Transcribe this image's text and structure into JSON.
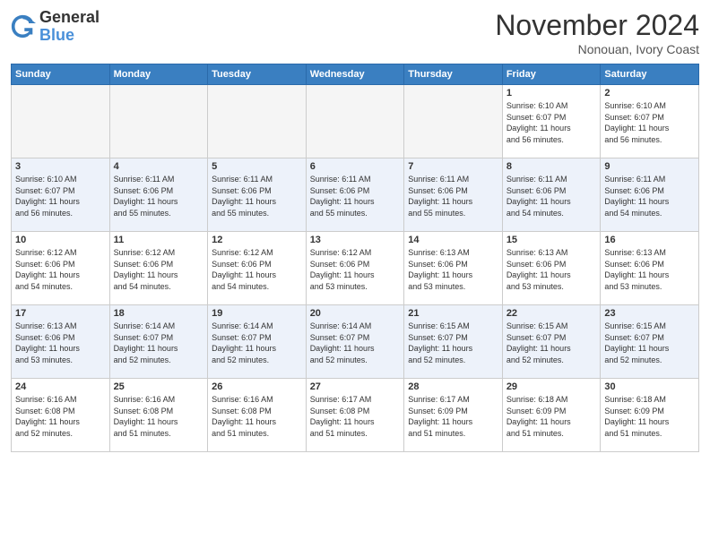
{
  "header": {
    "logo_line1": "General",
    "logo_line2": "Blue",
    "month": "November 2024",
    "location": "Nonouan, Ivory Coast"
  },
  "weekdays": [
    "Sunday",
    "Monday",
    "Tuesday",
    "Wednesday",
    "Thursday",
    "Friday",
    "Saturday"
  ],
  "weeks": [
    [
      {
        "day": "",
        "info": ""
      },
      {
        "day": "",
        "info": ""
      },
      {
        "day": "",
        "info": ""
      },
      {
        "day": "",
        "info": ""
      },
      {
        "day": "",
        "info": ""
      },
      {
        "day": "1",
        "info": "Sunrise: 6:10 AM\nSunset: 6:07 PM\nDaylight: 11 hours\nand 56 minutes."
      },
      {
        "day": "2",
        "info": "Sunrise: 6:10 AM\nSunset: 6:07 PM\nDaylight: 11 hours\nand 56 minutes."
      }
    ],
    [
      {
        "day": "3",
        "info": "Sunrise: 6:10 AM\nSunset: 6:07 PM\nDaylight: 11 hours\nand 56 minutes."
      },
      {
        "day": "4",
        "info": "Sunrise: 6:11 AM\nSunset: 6:06 PM\nDaylight: 11 hours\nand 55 minutes."
      },
      {
        "day": "5",
        "info": "Sunrise: 6:11 AM\nSunset: 6:06 PM\nDaylight: 11 hours\nand 55 minutes."
      },
      {
        "day": "6",
        "info": "Sunrise: 6:11 AM\nSunset: 6:06 PM\nDaylight: 11 hours\nand 55 minutes."
      },
      {
        "day": "7",
        "info": "Sunrise: 6:11 AM\nSunset: 6:06 PM\nDaylight: 11 hours\nand 55 minutes."
      },
      {
        "day": "8",
        "info": "Sunrise: 6:11 AM\nSunset: 6:06 PM\nDaylight: 11 hours\nand 54 minutes."
      },
      {
        "day": "9",
        "info": "Sunrise: 6:11 AM\nSunset: 6:06 PM\nDaylight: 11 hours\nand 54 minutes."
      }
    ],
    [
      {
        "day": "10",
        "info": "Sunrise: 6:12 AM\nSunset: 6:06 PM\nDaylight: 11 hours\nand 54 minutes."
      },
      {
        "day": "11",
        "info": "Sunrise: 6:12 AM\nSunset: 6:06 PM\nDaylight: 11 hours\nand 54 minutes."
      },
      {
        "day": "12",
        "info": "Sunrise: 6:12 AM\nSunset: 6:06 PM\nDaylight: 11 hours\nand 54 minutes."
      },
      {
        "day": "13",
        "info": "Sunrise: 6:12 AM\nSunset: 6:06 PM\nDaylight: 11 hours\nand 53 minutes."
      },
      {
        "day": "14",
        "info": "Sunrise: 6:13 AM\nSunset: 6:06 PM\nDaylight: 11 hours\nand 53 minutes."
      },
      {
        "day": "15",
        "info": "Sunrise: 6:13 AM\nSunset: 6:06 PM\nDaylight: 11 hours\nand 53 minutes."
      },
      {
        "day": "16",
        "info": "Sunrise: 6:13 AM\nSunset: 6:06 PM\nDaylight: 11 hours\nand 53 minutes."
      }
    ],
    [
      {
        "day": "17",
        "info": "Sunrise: 6:13 AM\nSunset: 6:06 PM\nDaylight: 11 hours\nand 53 minutes."
      },
      {
        "day": "18",
        "info": "Sunrise: 6:14 AM\nSunset: 6:07 PM\nDaylight: 11 hours\nand 52 minutes."
      },
      {
        "day": "19",
        "info": "Sunrise: 6:14 AM\nSunset: 6:07 PM\nDaylight: 11 hours\nand 52 minutes."
      },
      {
        "day": "20",
        "info": "Sunrise: 6:14 AM\nSunset: 6:07 PM\nDaylight: 11 hours\nand 52 minutes."
      },
      {
        "day": "21",
        "info": "Sunrise: 6:15 AM\nSunset: 6:07 PM\nDaylight: 11 hours\nand 52 minutes."
      },
      {
        "day": "22",
        "info": "Sunrise: 6:15 AM\nSunset: 6:07 PM\nDaylight: 11 hours\nand 52 minutes."
      },
      {
        "day": "23",
        "info": "Sunrise: 6:15 AM\nSunset: 6:07 PM\nDaylight: 11 hours\nand 52 minutes."
      }
    ],
    [
      {
        "day": "24",
        "info": "Sunrise: 6:16 AM\nSunset: 6:08 PM\nDaylight: 11 hours\nand 52 minutes."
      },
      {
        "day": "25",
        "info": "Sunrise: 6:16 AM\nSunset: 6:08 PM\nDaylight: 11 hours\nand 51 minutes."
      },
      {
        "day": "26",
        "info": "Sunrise: 6:16 AM\nSunset: 6:08 PM\nDaylight: 11 hours\nand 51 minutes."
      },
      {
        "day": "27",
        "info": "Sunrise: 6:17 AM\nSunset: 6:08 PM\nDaylight: 11 hours\nand 51 minutes."
      },
      {
        "day": "28",
        "info": "Sunrise: 6:17 AM\nSunset: 6:09 PM\nDaylight: 11 hours\nand 51 minutes."
      },
      {
        "day": "29",
        "info": "Sunrise: 6:18 AM\nSunset: 6:09 PM\nDaylight: 11 hours\nand 51 minutes."
      },
      {
        "day": "30",
        "info": "Sunrise: 6:18 AM\nSunset: 6:09 PM\nDaylight: 11 hours\nand 51 minutes."
      }
    ]
  ]
}
